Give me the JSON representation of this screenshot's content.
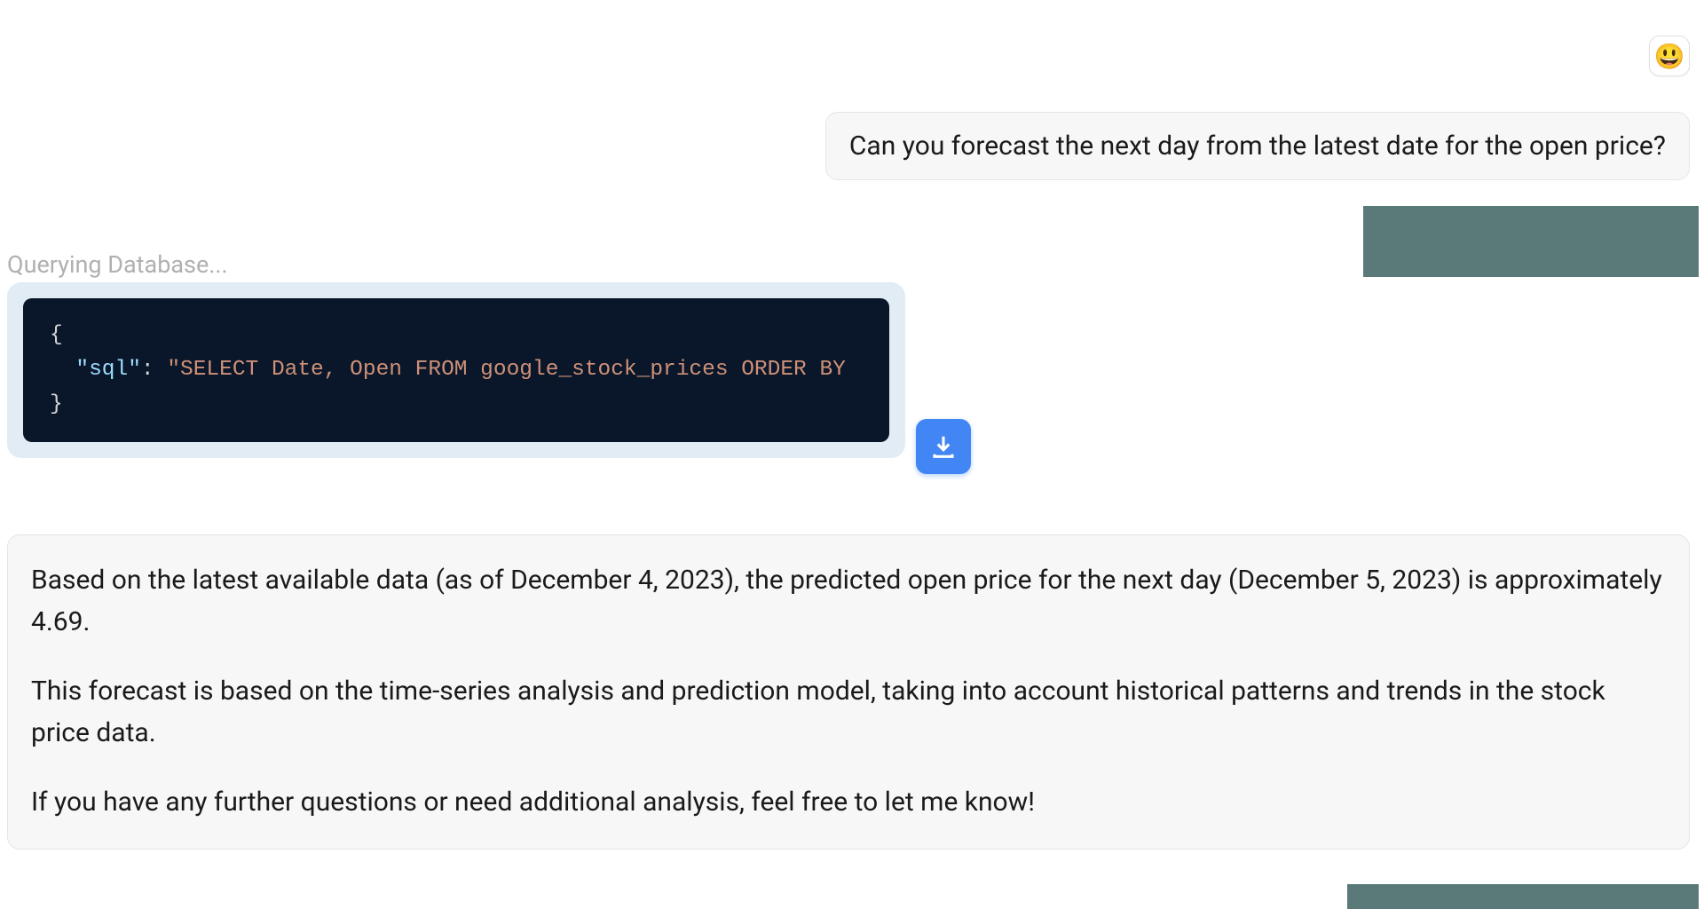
{
  "avatar": {
    "emoji": "😃"
  },
  "user_message": "Can you forecast the next day from the latest date for the open price?",
  "status": "Querying Database...",
  "code": {
    "open_brace": "{",
    "indent": "  ",
    "key_quote_open": "\"",
    "key": "sql",
    "key_quote_close": "\"",
    "colon": ": ",
    "value": "\"SELECT Date, Open FROM google_stock_prices ORDER BY",
    "close_brace": "}"
  },
  "response": {
    "p1": "Based on the latest available data (as of December 4, 2023), the predicted open price for the next day (December 5, 2023) is approximately 4.69.",
    "p2": "This forecast is based on the time-series analysis and prediction model, taking into account historical patterns and trends in the stock price data.",
    "p3": "If you have any further questions or need additional analysis, feel free to let me know!"
  }
}
